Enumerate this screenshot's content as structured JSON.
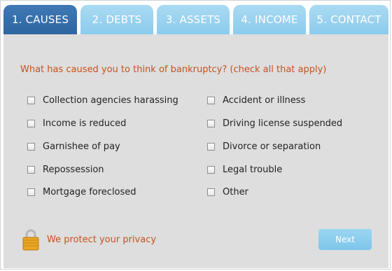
{
  "tabs": [
    {
      "label": "1. CAUSES",
      "active": true
    },
    {
      "label": "2. DEBTS",
      "active": false
    },
    {
      "label": "3. ASSETS",
      "active": false
    },
    {
      "label": "4. INCOME",
      "active": false
    },
    {
      "label": "5. CONTACT",
      "active": false
    }
  ],
  "question": "What has caused you to think of bankruptcy? (check all that apply)",
  "options_left": [
    {
      "label": "Collection agencies harassing",
      "checked": false
    },
    {
      "label": "Income is reduced",
      "checked": false
    },
    {
      "label": "Garnishee of pay",
      "checked": false
    },
    {
      "label": "Repossession",
      "checked": false
    },
    {
      "label": "Mortgage foreclosed",
      "checked": false
    }
  ],
  "options_right": [
    {
      "label": "Accident or illness",
      "checked": false
    },
    {
      "label": "Driving license suspended",
      "checked": false
    },
    {
      "label": "Divorce or separation",
      "checked": false
    },
    {
      "label": "Legal trouble",
      "checked": false
    },
    {
      "label": "Other",
      "checked": false
    }
  ],
  "privacy": {
    "text": "We protect your privacy",
    "icon": "lock-icon"
  },
  "next_label": "Next",
  "colors": {
    "tab_active": "#3170aa",
    "tab_inactive": "#95cfee",
    "panel": "#dedede",
    "accent_text": "#c3521d",
    "next_button": "#8ccbed"
  }
}
